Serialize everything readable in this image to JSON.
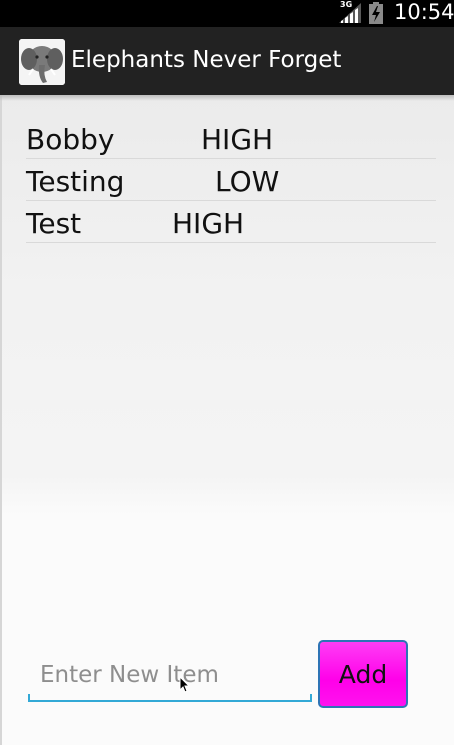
{
  "status_bar": {
    "network": "3G",
    "time": "10:54"
  },
  "action_bar": {
    "icon": "elephant-icon",
    "title": "Elephants Never Forget"
  },
  "items": [
    {
      "name": "Bobby",
      "priority": "HIGH"
    },
    {
      "name": "Testing",
      "priority": "LOW"
    },
    {
      "name": "Test",
      "priority": "HIGH"
    }
  ],
  "new_item": {
    "placeholder": "Enter New Item",
    "value": ""
  },
  "add_button": {
    "label": "Add"
  },
  "colors": {
    "accent": "#33a9d6",
    "button": "#ff00e9",
    "button_border": "#2e74b5",
    "action_bar": "#222222"
  }
}
